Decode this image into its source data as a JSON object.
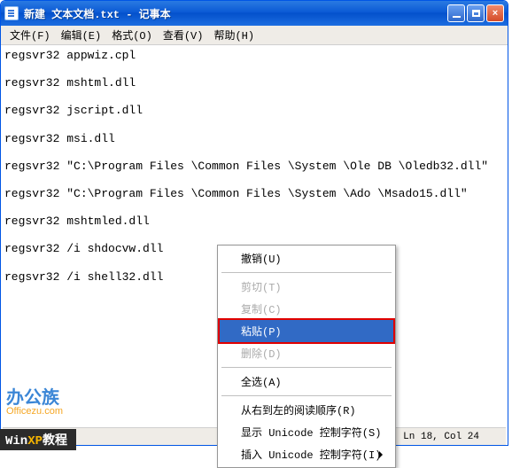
{
  "title": "新建 文本文档.txt - 记事本",
  "menus": {
    "file": "文件(F)",
    "edit": "编辑(E)",
    "format": "格式(O)",
    "view": "查看(V)",
    "help": "帮助(H)"
  },
  "lines": [
    "regsvr32 appwiz.cpl",
    "",
    "regsvr32 mshtml.dll",
    "",
    "regsvr32 jscript.dll",
    "",
    "regsvr32 msi.dll",
    "",
    "regsvr32 \"C:\\Program Files \\Common Files \\System \\Ole DB \\Oledb32.dll\"",
    "",
    "regsvr32 \"C:\\Program Files \\Common Files \\System \\Ado \\Msado15.dll\"",
    "",
    "regsvr32 mshtmled.dll",
    "",
    "regsvr32 /i shdocvw.dll",
    "",
    "regsvr32 /i shell32.dll"
  ],
  "context_menu": {
    "undo": "撤销(U)",
    "cut": "剪切(T)",
    "copy": "复制(C)",
    "paste": "粘贴(P)",
    "delete": "删除(D)",
    "select_all": "全选(A)",
    "rtl": "从右到左的阅读顺序(R)",
    "show_unicode": "显示 Unicode 控制字符(S)",
    "insert_unicode": "插入 Unicode 控制字符(I)"
  },
  "status": "Ln 18, Col 24",
  "watermark_site": "办公族",
  "watermark_site_sub": "Officezu.com",
  "watermark_tag_prefix": "Win",
  "watermark_tag_xp": "XP",
  "watermark_tag_suffix": "教程"
}
